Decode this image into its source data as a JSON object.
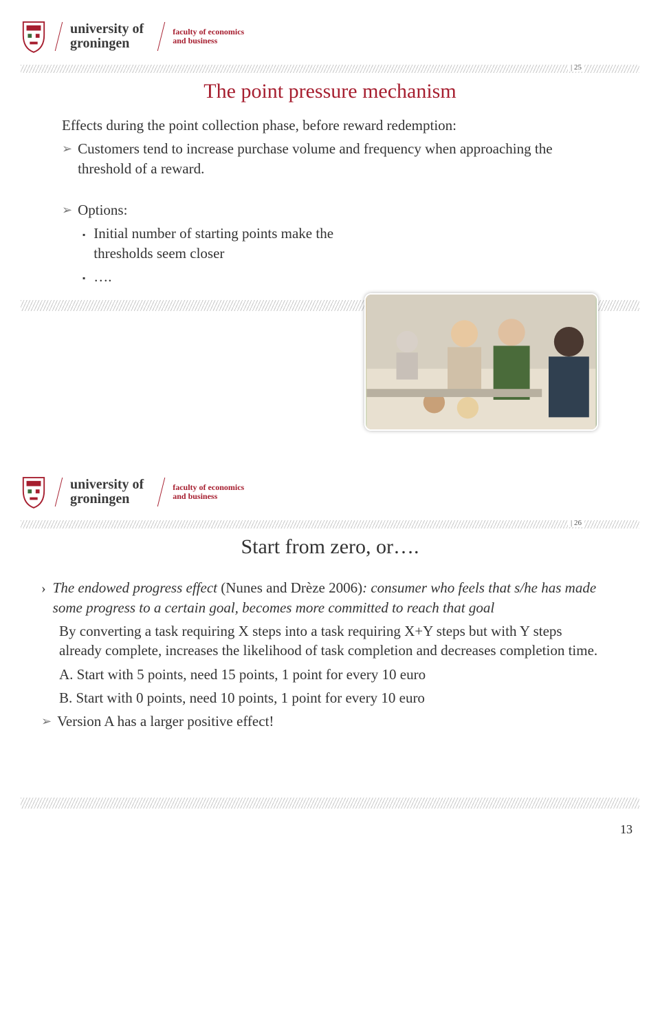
{
  "header": {
    "uni_line1": "university of",
    "uni_line2": "groningen",
    "fac_line1": "faculty of economics",
    "fac_line2": "and business"
  },
  "slide25": {
    "page_num": "| 25",
    "title": "The point pressure mechanism",
    "effects_line": "Effects during the point collection phase, before reward redemption:",
    "bullet1": "Customers tend to increase purchase volume and frequency when approaching the threshold of a reward.",
    "options_label": "Options:",
    "opt1": "Initial number of starting points make the thresholds seem closer",
    "opt2": "…."
  },
  "slide26": {
    "page_num": "| 26",
    "title": "Start from zero, or….",
    "b1a": "The endowed progress effect",
    "b1b": " (Nunes and Drèze 2006)",
    "b1c": ": consumer who feels that s/he has made some progress to a certain goal, becomes more committed to reach that goal",
    "b2": "By converting a task requiring X steps into a task requiring X+Y steps but with Y steps already complete, increases the likelihood of task completion and decreases completion time.",
    "optA": "A.  Start with 5 points, need 15 points, 1 point for every 10 euro",
    "optB": "B.  Start with 0 points, need 10 points, 1 point for every 10 euro",
    "concl": "Version A has a larger positive effect!"
  },
  "footer": {
    "page_num": "13"
  }
}
